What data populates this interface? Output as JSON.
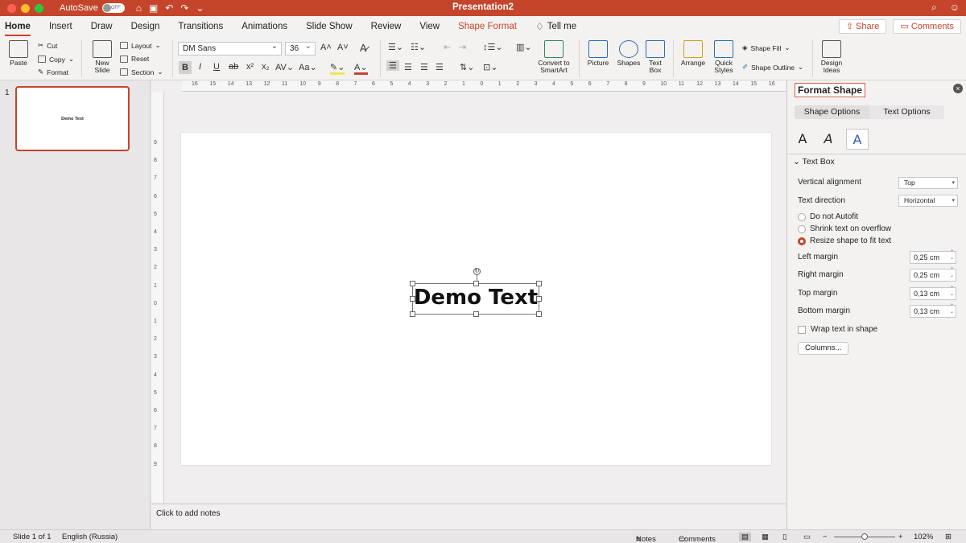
{
  "titlebar": {
    "autosave_label": "AutoSave",
    "autosave_state": "OFF",
    "doc_title": "Presentation2"
  },
  "tabs": [
    "Home",
    "Insert",
    "Draw",
    "Design",
    "Transitions",
    "Animations",
    "Slide Show",
    "Review",
    "View",
    "Shape Format",
    "Tell me"
  ],
  "tab_actions": {
    "share": "Share",
    "comments": "Comments"
  },
  "ribbon": {
    "paste": "Paste",
    "cut": "Cut",
    "copy": "Copy",
    "format": "Format",
    "new_slide_1": "New",
    "new_slide_2": "Slide",
    "layout": "Layout",
    "reset": "Reset",
    "section": "Section",
    "font_name": "DM Sans",
    "font_size": "36",
    "convert_1": "Convert to",
    "convert_2": "SmartArt",
    "picture": "Picture",
    "shapes": "Shapes",
    "text_box_1": "Text",
    "text_box_2": "Box",
    "arrange": "Arrange",
    "quick_1": "Quick",
    "quick_2": "Styles",
    "shape_fill": "Shape Fill",
    "shape_outline": "Shape Outline",
    "design_1": "Design",
    "design_2": "Ideas"
  },
  "thumbnail": {
    "number": "1",
    "text": "Demo Text"
  },
  "slide": {
    "text": "Demo Text"
  },
  "ruler": {
    "top": [
      "16",
      "15",
      "14",
      "13",
      "12",
      "11",
      "10",
      "9",
      "8",
      "7",
      "6",
      "5",
      "4",
      "3",
      "2",
      "1",
      "0",
      "1",
      "2",
      "3",
      "4",
      "5",
      "6",
      "7",
      "8",
      "9",
      "10",
      "11",
      "12",
      "13",
      "14",
      "15",
      "16"
    ],
    "left": [
      "9",
      "8",
      "7",
      "6",
      "5",
      "4",
      "3",
      "2",
      "1",
      "0",
      "1",
      "2",
      "3",
      "4",
      "5",
      "6",
      "7",
      "8",
      "9"
    ]
  },
  "notes_placeholder": "Click to add notes",
  "pane": {
    "title": "Format Shape",
    "tab_shape": "Shape Options",
    "tab_text": "Text Options",
    "section": "Text Box",
    "vertical_alignment_label": "Vertical alignment",
    "vertical_alignment_value": "Top",
    "text_direction_label": "Text direction",
    "text_direction_value": "Horizontal",
    "autofit_none": "Do not Autofit",
    "autofit_shrink": "Shrink text on overflow",
    "autofit_resize": "Resize shape to fit text",
    "left_margin_label": "Left margin",
    "left_margin_value": "0,25 cm",
    "right_margin_label": "Right margin",
    "right_margin_value": "0,25 cm",
    "top_margin_label": "Top margin",
    "top_margin_value": "0,13 cm",
    "bottom_margin_label": "Bottom margin",
    "bottom_margin_value": "0,13 cm",
    "wrap_label": "Wrap text in shape",
    "columns_button": "Columns..."
  },
  "status": {
    "slide_count": "Slide 1 of 1",
    "language": "English (Russia)",
    "notes": "Notes",
    "comments": "Comments",
    "zoom": "102%"
  },
  "colors": {
    "accent": "#c4452b"
  }
}
